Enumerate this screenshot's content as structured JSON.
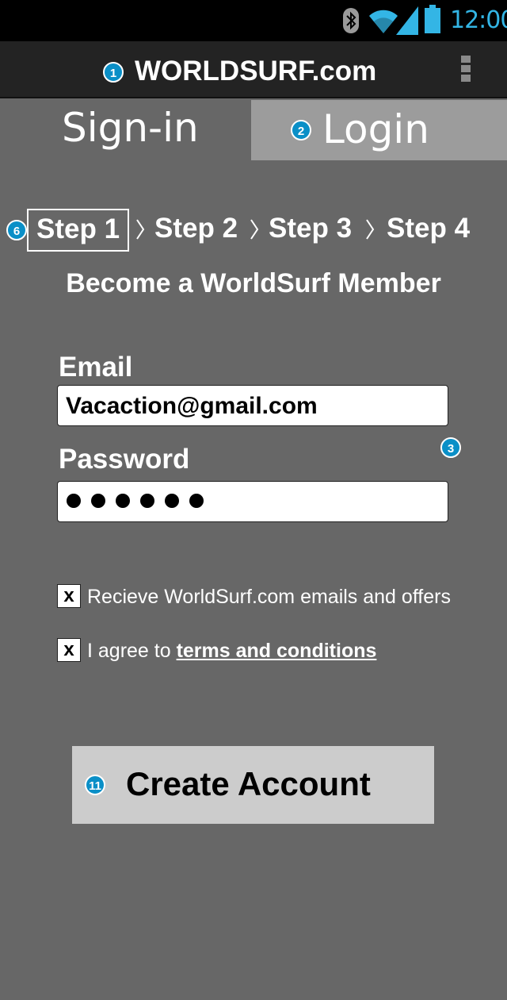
{
  "status_bar": {
    "time": "12:00",
    "icons": [
      "bluetooth-icon",
      "wifi-icon",
      "signal-icon",
      "battery-icon"
    ],
    "accent_color": "#33b5e5"
  },
  "action_bar": {
    "badge": "1",
    "title": "WORLDSURF.com",
    "overflow_icon": "overflow-menu-icon"
  },
  "tabs": {
    "signin_label": "Sign-in",
    "login_badge": "2",
    "login_label": "Login"
  },
  "steps": {
    "badge": "6",
    "items": [
      "Step 1",
      "Step 2",
      "Step 3",
      "Step 4"
    ],
    "active_index": 0
  },
  "headline": "Become a WorldSurf Member",
  "form": {
    "email_label": "Email",
    "email_value": "Vacaction@gmail.com",
    "password_label": "Password",
    "password_dot_count": 6,
    "badge": "3"
  },
  "checkboxes": {
    "offers": {
      "mark": "x",
      "text": "Recieve WorldSurf.com emails and offers"
    },
    "terms": {
      "mark": "x",
      "prefix": "I agree to ",
      "link": "terms and conditions"
    }
  },
  "create_button": {
    "badge": "11",
    "label": "Create Account"
  },
  "colors": {
    "background": "#676767",
    "action_bar": "#232323",
    "login_tab": "#9c9c9c",
    "button": "#cccccc",
    "badge": "#0a8fc7"
  }
}
